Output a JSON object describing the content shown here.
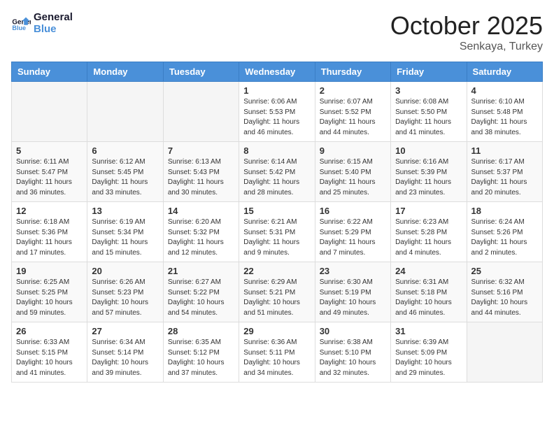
{
  "header": {
    "logo_line1": "General",
    "logo_line2": "Blue",
    "month": "October 2025",
    "location": "Senkaya, Turkey"
  },
  "weekdays": [
    "Sunday",
    "Monday",
    "Tuesday",
    "Wednesday",
    "Thursday",
    "Friday",
    "Saturday"
  ],
  "weeks": [
    [
      {
        "day": "",
        "sunrise": "",
        "sunset": "",
        "daylight": ""
      },
      {
        "day": "",
        "sunrise": "",
        "sunset": "",
        "daylight": ""
      },
      {
        "day": "",
        "sunrise": "",
        "sunset": "",
        "daylight": ""
      },
      {
        "day": "1",
        "sunrise": "Sunrise: 6:06 AM",
        "sunset": "Sunset: 5:53 PM",
        "daylight": "Daylight: 11 hours and 46 minutes."
      },
      {
        "day": "2",
        "sunrise": "Sunrise: 6:07 AM",
        "sunset": "Sunset: 5:52 PM",
        "daylight": "Daylight: 11 hours and 44 minutes."
      },
      {
        "day": "3",
        "sunrise": "Sunrise: 6:08 AM",
        "sunset": "Sunset: 5:50 PM",
        "daylight": "Daylight: 11 hours and 41 minutes."
      },
      {
        "day": "4",
        "sunrise": "Sunrise: 6:10 AM",
        "sunset": "Sunset: 5:48 PM",
        "daylight": "Daylight: 11 hours and 38 minutes."
      }
    ],
    [
      {
        "day": "5",
        "sunrise": "Sunrise: 6:11 AM",
        "sunset": "Sunset: 5:47 PM",
        "daylight": "Daylight: 11 hours and 36 minutes."
      },
      {
        "day": "6",
        "sunrise": "Sunrise: 6:12 AM",
        "sunset": "Sunset: 5:45 PM",
        "daylight": "Daylight: 11 hours and 33 minutes."
      },
      {
        "day": "7",
        "sunrise": "Sunrise: 6:13 AM",
        "sunset": "Sunset: 5:43 PM",
        "daylight": "Daylight: 11 hours and 30 minutes."
      },
      {
        "day": "8",
        "sunrise": "Sunrise: 6:14 AM",
        "sunset": "Sunset: 5:42 PM",
        "daylight": "Daylight: 11 hours and 28 minutes."
      },
      {
        "day": "9",
        "sunrise": "Sunrise: 6:15 AM",
        "sunset": "Sunset: 5:40 PM",
        "daylight": "Daylight: 11 hours and 25 minutes."
      },
      {
        "day": "10",
        "sunrise": "Sunrise: 6:16 AM",
        "sunset": "Sunset: 5:39 PM",
        "daylight": "Daylight: 11 hours and 23 minutes."
      },
      {
        "day": "11",
        "sunrise": "Sunrise: 6:17 AM",
        "sunset": "Sunset: 5:37 PM",
        "daylight": "Daylight: 11 hours and 20 minutes."
      }
    ],
    [
      {
        "day": "12",
        "sunrise": "Sunrise: 6:18 AM",
        "sunset": "Sunset: 5:36 PM",
        "daylight": "Daylight: 11 hours and 17 minutes."
      },
      {
        "day": "13",
        "sunrise": "Sunrise: 6:19 AM",
        "sunset": "Sunset: 5:34 PM",
        "daylight": "Daylight: 11 hours and 15 minutes."
      },
      {
        "day": "14",
        "sunrise": "Sunrise: 6:20 AM",
        "sunset": "Sunset: 5:32 PM",
        "daylight": "Daylight: 11 hours and 12 minutes."
      },
      {
        "day": "15",
        "sunrise": "Sunrise: 6:21 AM",
        "sunset": "Sunset: 5:31 PM",
        "daylight": "Daylight: 11 hours and 9 minutes."
      },
      {
        "day": "16",
        "sunrise": "Sunrise: 6:22 AM",
        "sunset": "Sunset: 5:29 PM",
        "daylight": "Daylight: 11 hours and 7 minutes."
      },
      {
        "day": "17",
        "sunrise": "Sunrise: 6:23 AM",
        "sunset": "Sunset: 5:28 PM",
        "daylight": "Daylight: 11 hours and 4 minutes."
      },
      {
        "day": "18",
        "sunrise": "Sunrise: 6:24 AM",
        "sunset": "Sunset: 5:26 PM",
        "daylight": "Daylight: 11 hours and 2 minutes."
      }
    ],
    [
      {
        "day": "19",
        "sunrise": "Sunrise: 6:25 AM",
        "sunset": "Sunset: 5:25 PM",
        "daylight": "Daylight: 10 hours and 59 minutes."
      },
      {
        "day": "20",
        "sunrise": "Sunrise: 6:26 AM",
        "sunset": "Sunset: 5:23 PM",
        "daylight": "Daylight: 10 hours and 57 minutes."
      },
      {
        "day": "21",
        "sunrise": "Sunrise: 6:27 AM",
        "sunset": "Sunset: 5:22 PM",
        "daylight": "Daylight: 10 hours and 54 minutes."
      },
      {
        "day": "22",
        "sunrise": "Sunrise: 6:29 AM",
        "sunset": "Sunset: 5:21 PM",
        "daylight": "Daylight: 10 hours and 51 minutes."
      },
      {
        "day": "23",
        "sunrise": "Sunrise: 6:30 AM",
        "sunset": "Sunset: 5:19 PM",
        "daylight": "Daylight: 10 hours and 49 minutes."
      },
      {
        "day": "24",
        "sunrise": "Sunrise: 6:31 AM",
        "sunset": "Sunset: 5:18 PM",
        "daylight": "Daylight: 10 hours and 46 minutes."
      },
      {
        "day": "25",
        "sunrise": "Sunrise: 6:32 AM",
        "sunset": "Sunset: 5:16 PM",
        "daylight": "Daylight: 10 hours and 44 minutes."
      }
    ],
    [
      {
        "day": "26",
        "sunrise": "Sunrise: 6:33 AM",
        "sunset": "Sunset: 5:15 PM",
        "daylight": "Daylight: 10 hours and 41 minutes."
      },
      {
        "day": "27",
        "sunrise": "Sunrise: 6:34 AM",
        "sunset": "Sunset: 5:14 PM",
        "daylight": "Daylight: 10 hours and 39 minutes."
      },
      {
        "day": "28",
        "sunrise": "Sunrise: 6:35 AM",
        "sunset": "Sunset: 5:12 PM",
        "daylight": "Daylight: 10 hours and 37 minutes."
      },
      {
        "day": "29",
        "sunrise": "Sunrise: 6:36 AM",
        "sunset": "Sunset: 5:11 PM",
        "daylight": "Daylight: 10 hours and 34 minutes."
      },
      {
        "day": "30",
        "sunrise": "Sunrise: 6:38 AM",
        "sunset": "Sunset: 5:10 PM",
        "daylight": "Daylight: 10 hours and 32 minutes."
      },
      {
        "day": "31",
        "sunrise": "Sunrise: 6:39 AM",
        "sunset": "Sunset: 5:09 PM",
        "daylight": "Daylight: 10 hours and 29 minutes."
      },
      {
        "day": "",
        "sunrise": "",
        "sunset": "",
        "daylight": ""
      }
    ]
  ]
}
